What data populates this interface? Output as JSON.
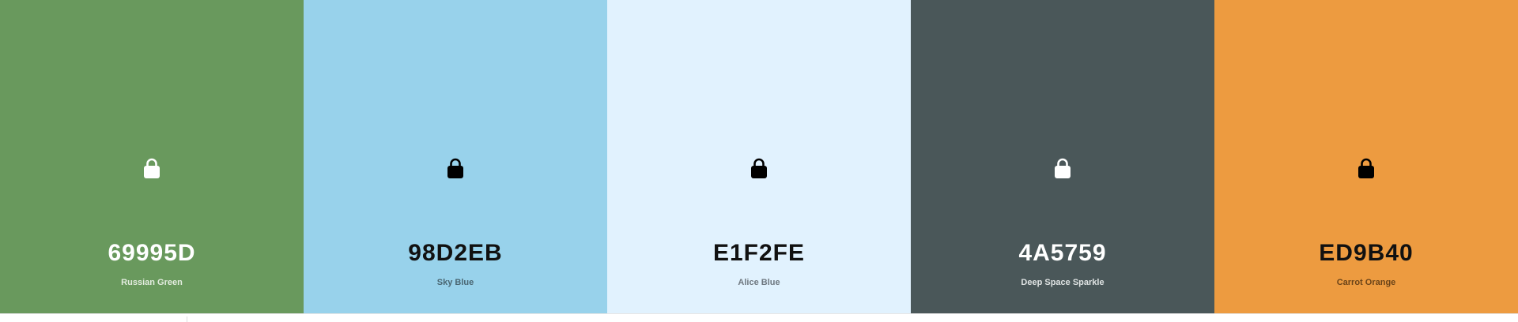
{
  "palette": {
    "swatches": [
      {
        "hex": "69995D",
        "name": "Russian Green",
        "color": "#69995D",
        "text_color": "#ffffff",
        "name_color": "#e3ecdf",
        "lock_color": "#ffffff",
        "lock_icon": "lock-icon"
      },
      {
        "hex": "98D2EB",
        "name": "Sky Blue",
        "color": "#98D2EB",
        "text_color": "#111111",
        "name_color": "#4a6672",
        "lock_color": "#000000",
        "lock_icon": "lock-icon"
      },
      {
        "hex": "E1F2FE",
        "name": "Alice Blue",
        "color": "#E1F2FE",
        "text_color": "#111111",
        "name_color": "#6f7880",
        "lock_color": "#000000",
        "lock_icon": "lock-icon"
      },
      {
        "hex": "4A5759",
        "name": "Deep Space Sparkle",
        "color": "#4A5759",
        "text_color": "#ffffff",
        "name_color": "#dfe3e3",
        "lock_color": "#ffffff",
        "lock_icon": "lock-icon"
      },
      {
        "hex": "ED9B40",
        "name": "Carrot Orange",
        "color": "#ED9B40",
        "text_color": "#111111",
        "name_color": "#6b4419",
        "lock_color": "#000000",
        "lock_icon": "lock-icon"
      }
    ]
  }
}
